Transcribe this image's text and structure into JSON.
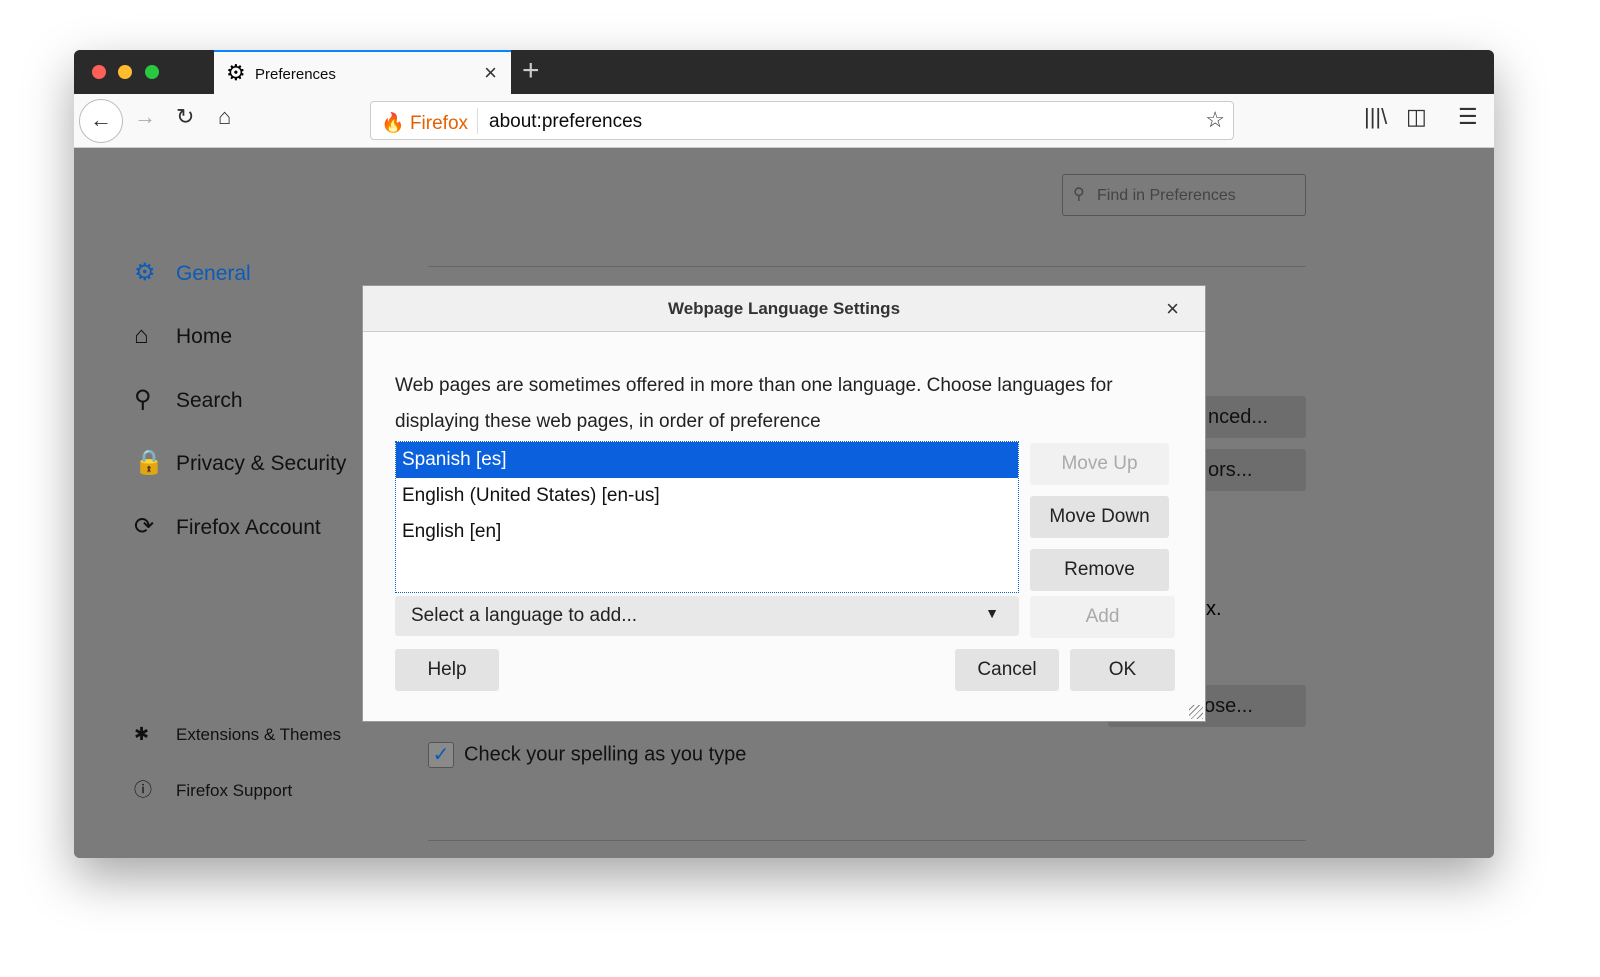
{
  "browser": {
    "tab_title": "Preferences",
    "identity": "Firefox",
    "url": "about:preferences",
    "colors": {
      "accent": "#0a84ff",
      "selection": "#0a60dd"
    }
  },
  "prefs": {
    "search_placeholder": "Find in Preferences",
    "sidebar": [
      {
        "label": "General",
        "icon": "gear-icon"
      },
      {
        "label": "Home",
        "icon": "home-icon"
      },
      {
        "label": "Search",
        "icon": "search-icon"
      },
      {
        "label": "Privacy & Security",
        "icon": "lock-icon"
      },
      {
        "label": "Firefox Account",
        "icon": "sync-icon"
      }
    ],
    "footer": [
      {
        "label": "Extensions & Themes"
      },
      {
        "label": "Firefox Support"
      }
    ],
    "bg_buttons": [
      "nced...",
      "ors...",
      "ose..."
    ],
    "bg_text": "x.",
    "spell_check": "Check your spelling as you type",
    "spell_checked": true
  },
  "dialog": {
    "title": "Webpage Language Settings",
    "description": "Web pages are sometimes offered in more than one language. Choose languages for displaying these web pages, in order of preference",
    "languages": [
      "Spanish [es]",
      "English (United States) [en-us]",
      "English [en]"
    ],
    "selected": 0,
    "move_up": "Move Up",
    "move_down": "Move Down",
    "remove": "Remove",
    "add": "Add",
    "select_placeholder": "Select a language to add...",
    "help": "Help",
    "cancel": "Cancel",
    "ok": "OK"
  }
}
